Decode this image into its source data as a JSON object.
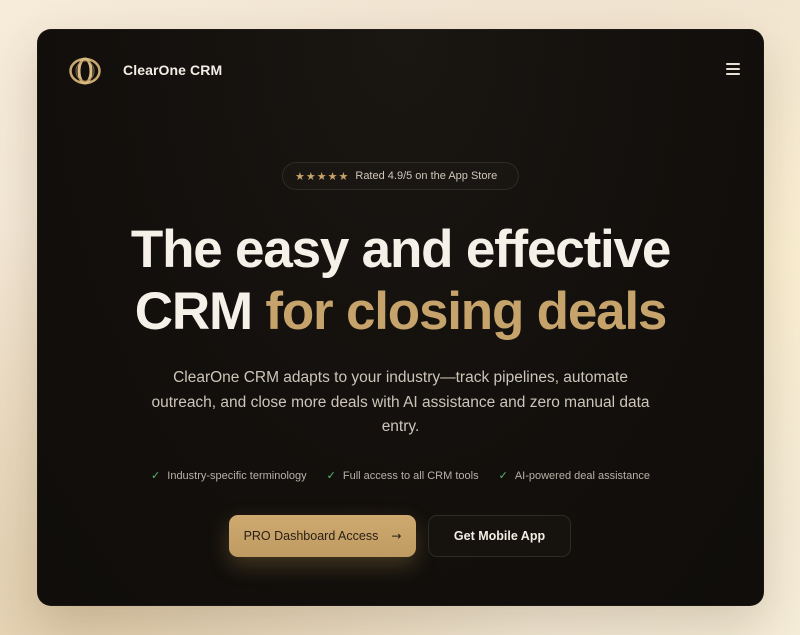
{
  "nav": {
    "brand": "ClearOne CRM",
    "logo_icon": "interlocking-rings-icon",
    "menu_icon": "hamburger-menu-icon"
  },
  "rating": {
    "stars": 5,
    "text": "Rated 4.9/5 on the App Store"
  },
  "hero": {
    "headline_line1": "The easy and effective",
    "headline_line2_plain": "CRM ",
    "headline_line2_accent": "for closing deals",
    "subtitle": "ClearOne CRM adapts to your industry—track pipelines, automate outreach, and close more deals with AI assistance and zero manual data entry."
  },
  "features": [
    {
      "label": "Industry-specific terminology"
    },
    {
      "label": "Full access to all CRM tools"
    },
    {
      "label": "AI-powered deal assistance"
    }
  ],
  "cta": {
    "primary_label": "PRO Dashboard Access",
    "secondary_label": "Get Mobile App"
  },
  "colors": {
    "accent_gold": "#c6a36b",
    "card_bg": "#120f0c",
    "check_green": "#58b96e"
  }
}
